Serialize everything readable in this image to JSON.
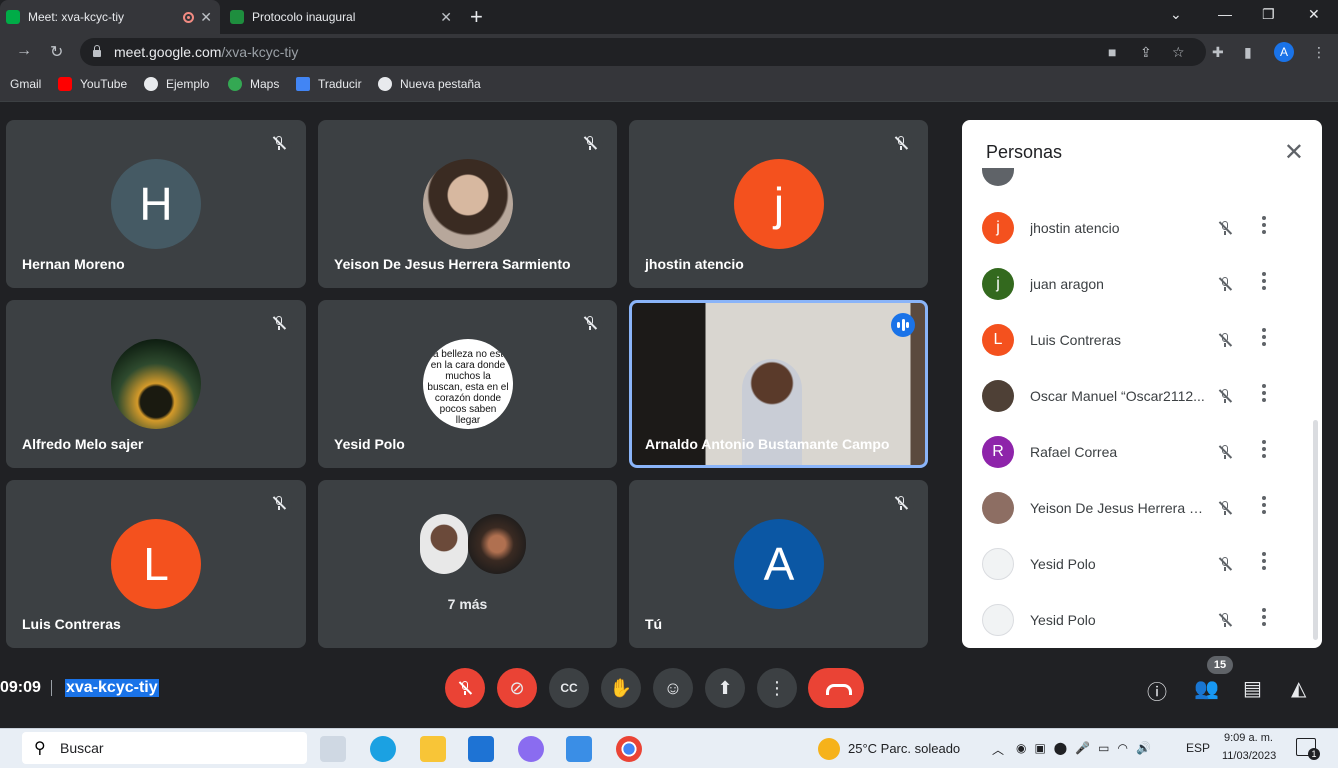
{
  "tabs": [
    {
      "title": "Meet: xva-kcyc-tiy",
      "active": true
    },
    {
      "title": "Protocolo inaugural",
      "active": false
    }
  ],
  "address": {
    "domain": "meet.google.com",
    "path": "/xva-kcyc-tiy",
    "profile": "A"
  },
  "bookmarks": [
    "Gmail",
    "YouTube",
    "Ejemplo",
    "Maps",
    "Traducir",
    "Nueva pestaña"
  ],
  "tiles": [
    {
      "name": "Hernan Moreno",
      "initial": "H",
      "color": "#455a64"
    },
    {
      "name": "Yeison De Jesus Herrera Sarmiento",
      "initial": "",
      "color": "#8d6e63"
    },
    {
      "name": "jhostin atencio",
      "initial": "j",
      "color": "#f4511e"
    },
    {
      "name": "Alfredo Melo sajer",
      "initial": "",
      "color": "#2e4a2e"
    },
    {
      "name": "Yesid Polo",
      "initial": "",
      "color": "#ffffff"
    },
    {
      "name": "Arnaldo Antonio Bustamante Campo",
      "initial": "",
      "color": "#6d5a4c"
    },
    {
      "name": "Luis Contreras",
      "initial": "L",
      "color": "#f4511e"
    },
    {
      "name": "7 más",
      "initial": "",
      "color": "#3c4043"
    },
    {
      "name": "Tú",
      "initial": "A",
      "color": "#0b57a4"
    }
  ],
  "yesid_quote": "La belleza no esta en la cara donde muchos la buscan, esta en el corazón donde pocos saben llegar",
  "people_panel": {
    "title": "Personas",
    "people": [
      {
        "name": "jhostin atencio",
        "initial": "j",
        "color": "#f4511e"
      },
      {
        "name": "juan aragon",
        "initial": "j",
        "color": "#33691e"
      },
      {
        "name": "Luis Contreras",
        "initial": "L",
        "color": "#f4511e"
      },
      {
        "name": "Oscar Manuel “Oscar2112...",
        "initial": "",
        "color": "#4e4036"
      },
      {
        "name": "Rafael Correa",
        "initial": "R",
        "color": "#8e24aa"
      },
      {
        "name": "Yeison De Jesus Herrera S...",
        "initial": "",
        "color": "#8d6e63"
      },
      {
        "name": "Yesid Polo",
        "initial": "",
        "color": "#f1f3f4"
      },
      {
        "name": "Yesid Polo",
        "initial": "",
        "color": "#f1f3f4"
      }
    ]
  },
  "footer": {
    "time": "09:09",
    "meeting_code": "xva-kcyc-tiy",
    "people_count": "15"
  },
  "taskbar": {
    "search": "Buscar",
    "weather": "25°C  Parc. soleado",
    "lang": "ESP",
    "clock_time": "9:09 a. m.",
    "clock_date": "11/03/2023",
    "notifications": "1"
  }
}
